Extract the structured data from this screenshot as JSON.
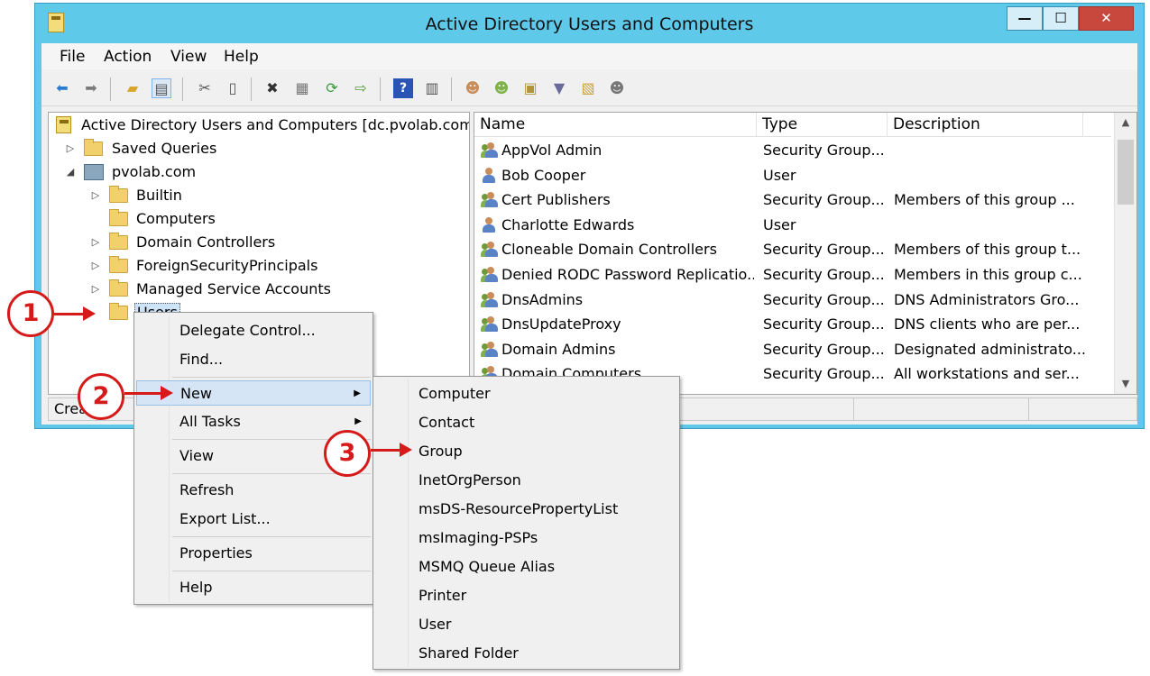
{
  "window": {
    "title": "Active Directory Users and Computers",
    "controls": {
      "minimize": "—",
      "maximize": "☐",
      "close": "✕"
    }
  },
  "menubar": [
    "File",
    "Action",
    "View",
    "Help"
  ],
  "toolbar": {
    "icons": [
      "back-icon",
      "forward-icon",
      "up-folder-icon",
      "show-hide-console-tree-icon",
      "cut-icon",
      "paste-icon",
      "delete-icon",
      "properties-icon",
      "refresh-icon",
      "export-list-icon",
      "help-icon",
      "action-pane-icon",
      "new-user-icon",
      "new-group-icon",
      "new-ou-icon",
      "filter-icon",
      "find-icon",
      "add-to-group-icon"
    ]
  },
  "tree": {
    "root": "Active Directory Users and Computers [dc.pvolab.com]",
    "items": [
      {
        "label": "Saved Queries",
        "arrow": "▷"
      },
      {
        "label": "pvolab.com",
        "arrow": "◢"
      },
      {
        "label": "Builtin",
        "arrow": "▷"
      },
      {
        "label": "Computers",
        "arrow": ""
      },
      {
        "label": "Domain Controllers",
        "arrow": "▷"
      },
      {
        "label": "ForeignSecurityPrincipals",
        "arrow": "▷"
      },
      {
        "label": "Managed Service Accounts",
        "arrow": "▷"
      },
      {
        "label": "Users",
        "arrow": ""
      }
    ]
  },
  "list": {
    "columns": [
      "Name",
      "Type",
      "Description"
    ],
    "rows": [
      {
        "name": "AppVol Admin",
        "type": "Security Group...",
        "description": "",
        "icon": "group-icon"
      },
      {
        "name": "Bob Cooper",
        "type": "User",
        "description": "",
        "icon": "user-icon"
      },
      {
        "name": "Cert Publishers",
        "type": "Security Group...",
        "description": "Members of this group ...",
        "icon": "group-icon"
      },
      {
        "name": "Charlotte Edwards",
        "type": "User",
        "description": "",
        "icon": "user-icon"
      },
      {
        "name": "Cloneable Domain Controllers",
        "type": "Security Group...",
        "description": "Members of this group t...",
        "icon": "group-icon"
      },
      {
        "name": "Denied RODC Password Replicatio...",
        "type": "Security Group...",
        "description": "Members in this group c...",
        "icon": "group-icon"
      },
      {
        "name": "DnsAdmins",
        "type": "Security Group...",
        "description": "DNS Administrators Gro...",
        "icon": "group-icon"
      },
      {
        "name": "DnsUpdateProxy",
        "type": "Security Group...",
        "description": "DNS clients who are per...",
        "icon": "group-icon"
      },
      {
        "name": "Domain Admins",
        "type": "Security Group...",
        "description": "Designated administrato...",
        "icon": "group-icon"
      },
      {
        "name": "Domain Computers",
        "type": "Security Group...",
        "description": "All workstations and ser...",
        "icon": "group-icon"
      }
    ]
  },
  "statusbar": {
    "text": "Crea"
  },
  "context_menu": {
    "items": [
      "Delegate Control...",
      "Find...",
      "New",
      "All Tasks",
      "View",
      "Refresh",
      "Export List...",
      "Properties",
      "Help"
    ],
    "submenu_arrow": "▶"
  },
  "new_submenu": {
    "items": [
      "Computer",
      "Contact",
      "Group",
      "InetOrgPerson",
      "msDS-ResourcePropertyList",
      "msImaging-PSPs",
      "MSMQ Queue Alias",
      "Printer",
      "User",
      "Shared Folder"
    ]
  },
  "callouts": [
    "1",
    "2",
    "3"
  ],
  "colors": {
    "titlebar": "#5fc9ea",
    "close_button": "#c9483e",
    "callout_red": "#d61a1a",
    "highlight": "#d5e5f5"
  }
}
